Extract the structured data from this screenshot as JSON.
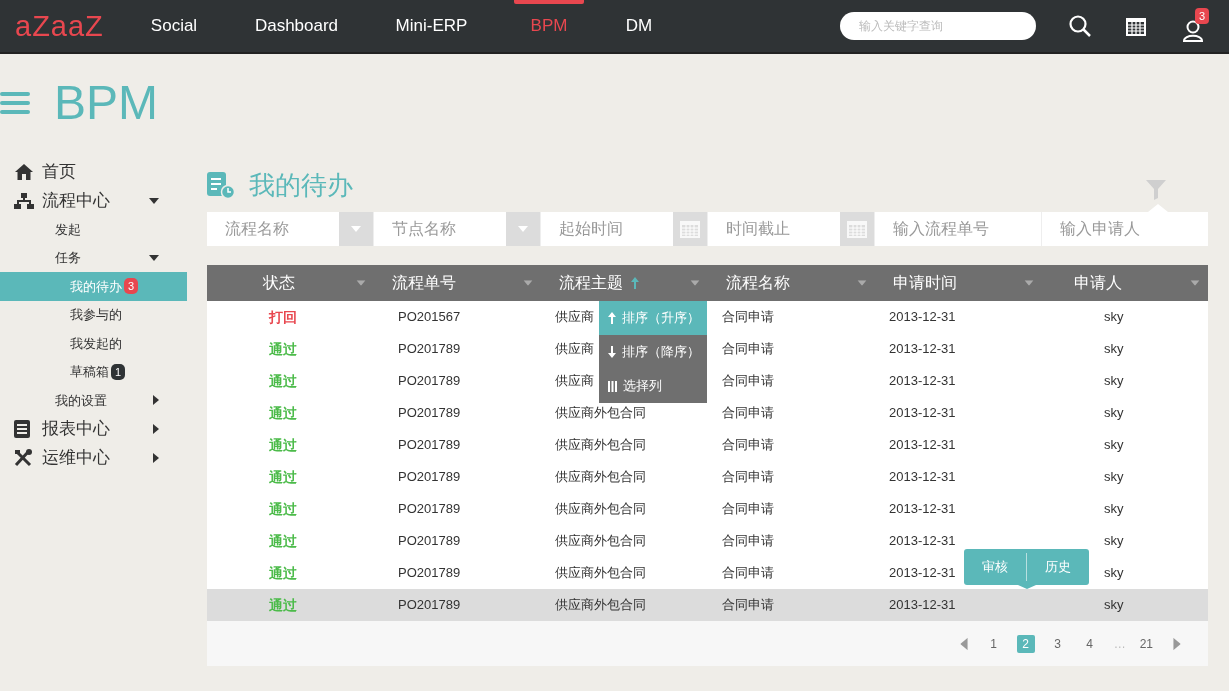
{
  "logo": "aZaaZ",
  "nav": [
    {
      "label": "Social",
      "selected": false
    },
    {
      "label": "Dashboard",
      "selected": false
    },
    {
      "label": "Mini-ERP",
      "selected": false
    },
    {
      "label": "BPM",
      "selected": true
    },
    {
      "label": "DM",
      "selected": false
    }
  ],
  "search": {
    "placeholder": "输入关键字查询"
  },
  "user_badge": "3",
  "app_title": "BPM",
  "sidebar": {
    "items": [
      {
        "label": "首页"
      },
      {
        "label": "流程中心",
        "expanded": true,
        "children": [
          {
            "label": "发起"
          },
          {
            "label": "任务",
            "expanded": true,
            "children": [
              {
                "label": "我的待办",
                "selected": true,
                "badge": "3",
                "color": "#e8474f"
              },
              {
                "label": "我参与的",
                "selected": false
              },
              {
                "label": "我发起的",
                "selected": false
              },
              {
                "label": "草稿箱",
                "selected": false,
                "badge": "1",
                "color": "#2f3335"
              }
            ]
          },
          {
            "label": "我的设置",
            "expanded": false
          }
        ]
      },
      {
        "label": "报表中心",
        "expanded": false
      },
      {
        "label": "运维中心",
        "expanded": false
      }
    ]
  },
  "page_title": "我的待办",
  "filters": [
    {
      "kind": "select",
      "placeholder": "流程名称"
    },
    {
      "kind": "select",
      "placeholder": "节点名称"
    },
    {
      "kind": "date",
      "placeholder": "起始时间"
    },
    {
      "kind": "date",
      "placeholder": "时间截止"
    },
    {
      "kind": "text",
      "placeholder": "输入流程单号"
    },
    {
      "kind": "text",
      "placeholder": "输入申请人"
    }
  ],
  "table": {
    "columns": [
      {
        "label": "状态",
        "sorted": false
      },
      {
        "label": "流程单号",
        "sorted": false
      },
      {
        "label": "流程主题",
        "sorted": true,
        "menu": [
          {
            "label": "排序（升序）",
            "kind": "asc",
            "selected": true
          },
          {
            "label": "排序（降序）",
            "kind": "desc",
            "selected": false
          },
          {
            "label": "选择列",
            "kind": "columns",
            "selected": false
          }
        ]
      },
      {
        "label": "流程名称",
        "sorted": false
      },
      {
        "label": "申请时间",
        "sorted": false
      },
      {
        "label": "申请人",
        "sorted": false
      }
    ],
    "rows": [
      {
        "selected": false,
        "color": "#e8474f",
        "cells": [
          "打回",
          "PO201567",
          "供应商",
          "合同申请",
          "2013-12-31",
          "sky"
        ]
      },
      {
        "selected": false,
        "color": "#4cbb4a",
        "cells": [
          "通过",
          "PO201789",
          "供应商",
          "合同申请",
          "2013-12-31",
          "sky"
        ]
      },
      {
        "selected": false,
        "color": "#4cbb4a",
        "cells": [
          "通过",
          "PO201789",
          "供应商",
          "合同申请",
          "2013-12-31",
          "sky"
        ]
      },
      {
        "selected": false,
        "color": "#4cbb4a",
        "cells": [
          "通过",
          "PO201789",
          "供应商外包合同",
          "合同申请",
          "2013-12-31",
          "sky"
        ]
      },
      {
        "selected": false,
        "color": "#4cbb4a",
        "cells": [
          "通过",
          "PO201789",
          "供应商外包合同",
          "合同申请",
          "2013-12-31",
          "sky"
        ]
      },
      {
        "selected": false,
        "color": "#4cbb4a",
        "cells": [
          "通过",
          "PO201789",
          "供应商外包合同",
          "合同申请",
          "2013-12-31",
          "sky"
        ]
      },
      {
        "selected": false,
        "color": "#4cbb4a",
        "cells": [
          "通过",
          "PO201789",
          "供应商外包合同",
          "合同申请",
          "2013-12-31",
          "sky"
        ]
      },
      {
        "selected": false,
        "color": "#4cbb4a",
        "cells": [
          "通过",
          "PO201789",
          "供应商外包合同",
          "合同申请",
          "2013-12-31",
          "sky"
        ]
      },
      {
        "selected": false,
        "color": "#4cbb4a",
        "cells": [
          "通过",
          "PO201789",
          "供应商外包合同",
          "合同申请",
          "2013-12-31",
          "sky"
        ]
      },
      {
        "selected": true,
        "color": "#4cbb4a",
        "cells": [
          "通过",
          "PO201789",
          "供应商外包合同",
          "合同申请",
          "2013-12-31",
          "sky"
        ],
        "actions": [
          "审核",
          "历史"
        ]
      }
    ]
  },
  "pagination": [
    {
      "kind": "prev"
    },
    {
      "kind": "page",
      "label": "1",
      "selected": false
    },
    {
      "kind": "page",
      "label": "2",
      "selected": true
    },
    {
      "kind": "page",
      "label": "3",
      "selected": false
    },
    {
      "kind": "page",
      "label": "4",
      "selected": false
    },
    {
      "kind": "ellipsis",
      "label": "…"
    },
    {
      "kind": "page",
      "label": "21",
      "selected": false
    },
    {
      "kind": "next"
    }
  ]
}
